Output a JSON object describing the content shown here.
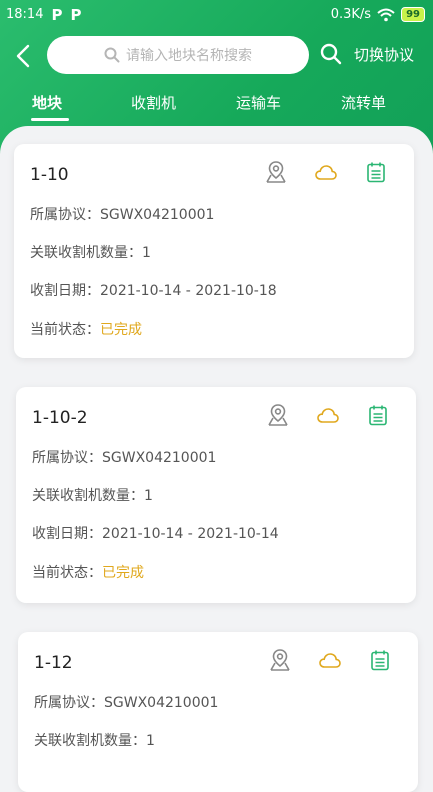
{
  "status_bar": {
    "time": "18:14",
    "net_speed": "0.3K/s",
    "battery": "99"
  },
  "search": {
    "placeholder": "请输入地块名称搜索"
  },
  "header": {
    "switch_label": "切换协议"
  },
  "tabs": [
    {
      "label": "地块",
      "active": true
    },
    {
      "label": "收割机",
      "active": false
    },
    {
      "label": "运输车",
      "active": false
    },
    {
      "label": "流转单",
      "active": false
    }
  ],
  "field_labels": {
    "agreement": "所属协议：",
    "harvesters": "关联收割机数量：",
    "harvest_date": "收割日期：",
    "status": "当前状态："
  },
  "cards": [
    {
      "title": "1-10",
      "agreement": "SGWX04210001",
      "harvesters": "1",
      "harvest_date": "2021-10-14 - 2021-10-18",
      "status": "已完成"
    },
    {
      "title": "1-10-2",
      "agreement": "SGWX04210001",
      "harvesters": "1",
      "harvest_date": "2021-10-14 - 2021-10-14",
      "status": "已完成"
    },
    {
      "title": "1-12",
      "agreement": "SGWX04210001",
      "harvesters": "1"
    }
  ],
  "icons": {
    "location": "map-pin-icon",
    "weather": "cloud-icon",
    "calendar": "calendar-icon"
  },
  "colors": {
    "primary_green": "#1aab5e",
    "status_done": "#e0a81e",
    "cloud": "#e0a81e",
    "calendar": "#2bb673"
  }
}
